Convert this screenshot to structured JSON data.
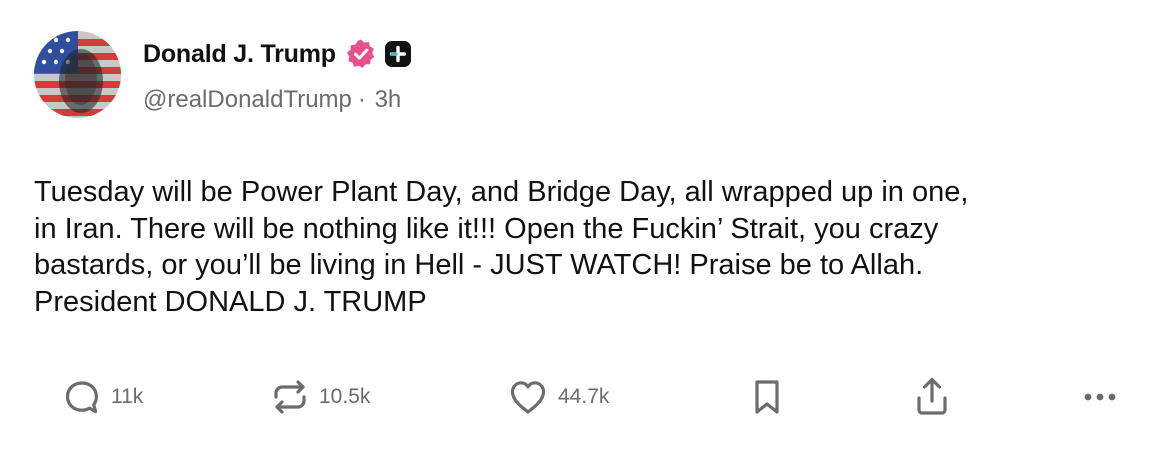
{
  "author": {
    "display_name": "Donald J. Trump",
    "handle": "@realDonaldTrump",
    "separator": "·",
    "time_ago": "3h"
  },
  "post": {
    "text": "Tuesday will be Power Plant Day, and Bridge Day, all wrapped up in one,\nin Iran. There will be nothing like it!!! Open the Fuckin’ Strait, you crazy\nbastards, or you’ll be living in Hell - JUST WATCH! Praise be to Allah.\nPresident DONALD J. TRUMP"
  },
  "actions": {
    "replies": "11k",
    "reposts": "10.5k",
    "likes": "44.7k"
  },
  "icons": {
    "verified": "verified-badge-icon",
    "plus": "plus-badge-icon",
    "reply": "reply-icon",
    "repost": "repost-icon",
    "like": "heart-icon",
    "bookmark": "bookmark-icon",
    "share": "share-icon",
    "more": "more-icon"
  },
  "colors": {
    "verified": "#e7508a",
    "text": "#111111",
    "muted": "#6b6b70"
  }
}
